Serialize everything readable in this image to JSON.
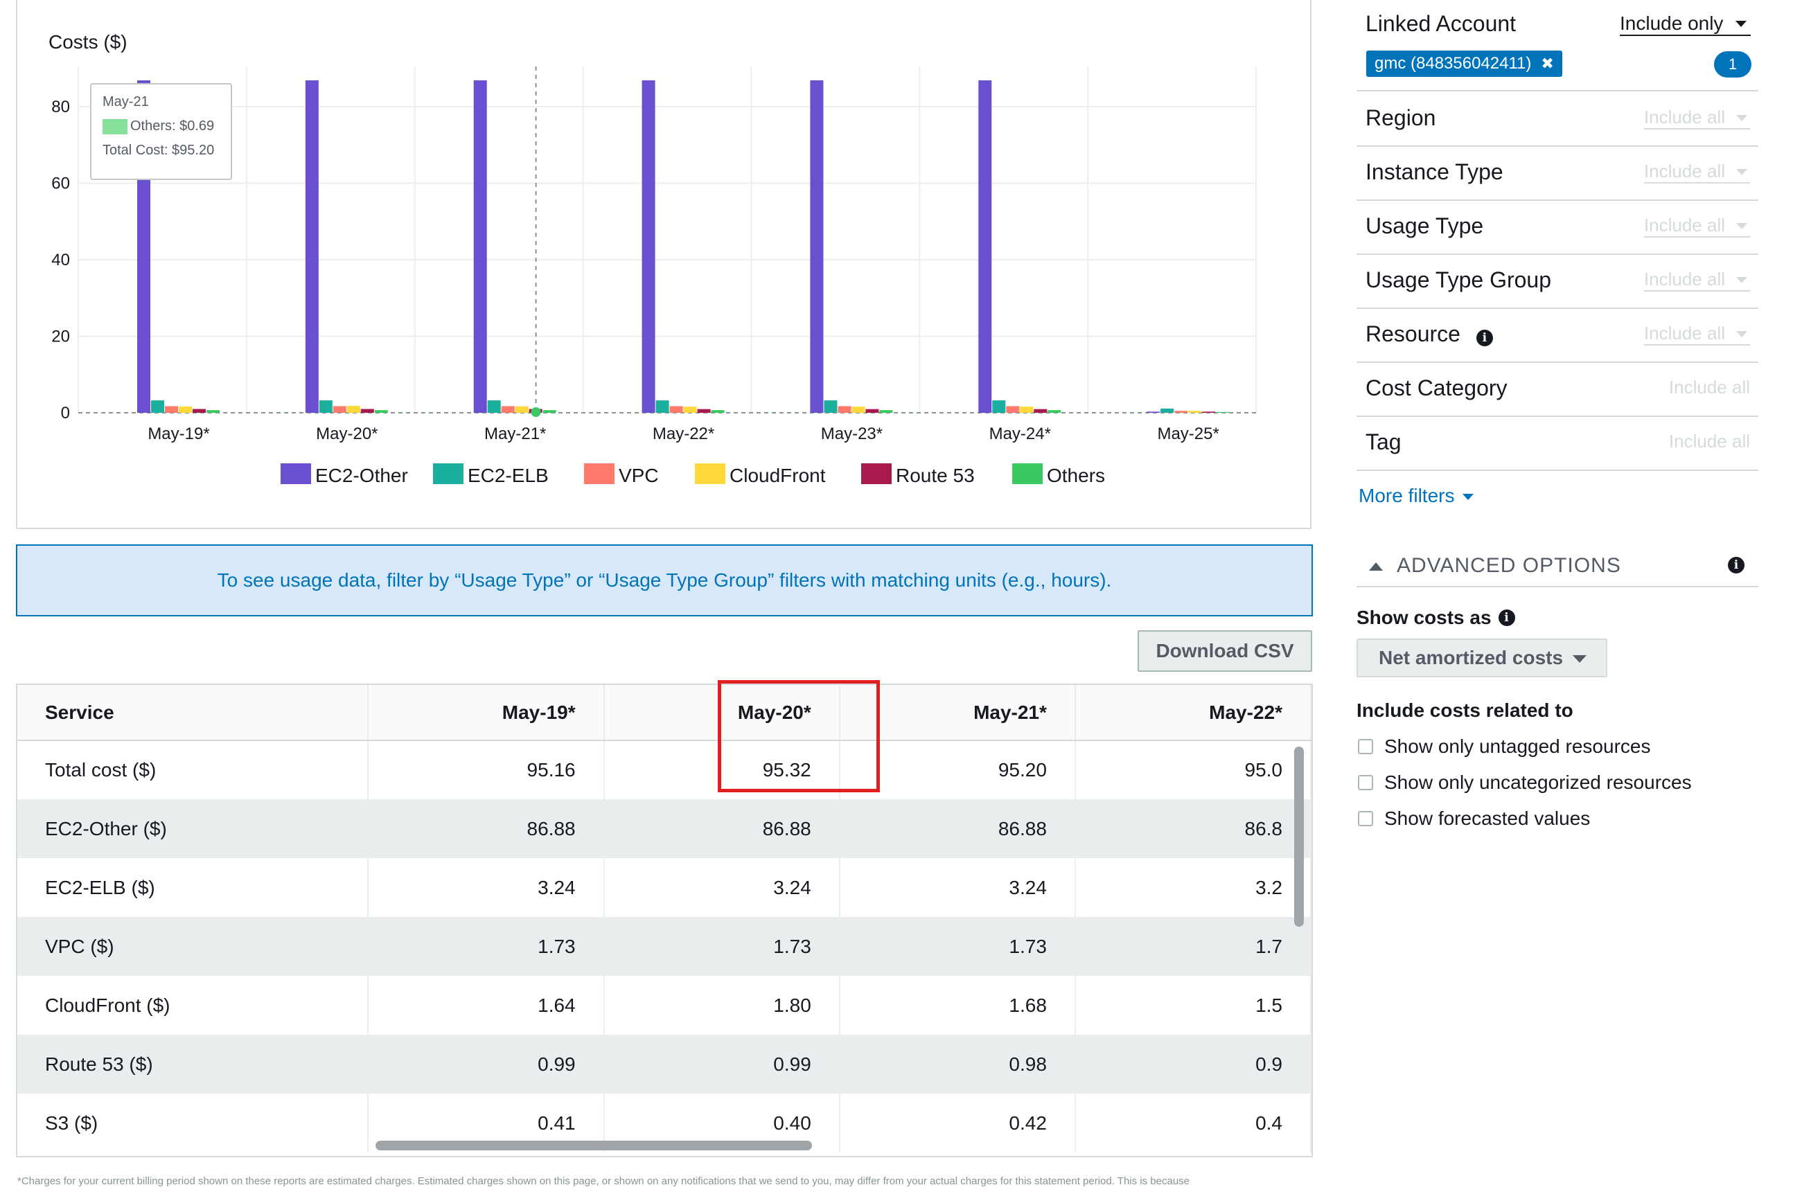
{
  "chart": {
    "ylabel": "Costs ($)",
    "tooltip": {
      "date": "May-21",
      "series_line": "Others: $0.69",
      "total_line": "Total Cost: $95.20"
    }
  },
  "chart_data": {
    "type": "bar",
    "title": "",
    "ylabel": "Costs ($)",
    "ylim": [
      0,
      86.88
    ],
    "yticks": [
      0,
      20,
      40,
      60,
      80
    ],
    "categories": [
      "May-19*",
      "May-20*",
      "May-21*",
      "May-22*",
      "May-23*",
      "May-24*",
      "May-25*"
    ],
    "series": [
      {
        "name": "EC2-Other",
        "color": "#6a4fd1",
        "values": [
          86.88,
          86.88,
          86.88,
          86.88,
          86.88,
          86.88,
          0.3
        ]
      },
      {
        "name": "EC2-ELB",
        "color": "#1bb09e",
        "values": [
          3.24,
          3.24,
          3.24,
          3.24,
          3.24,
          3.24,
          1.1
        ]
      },
      {
        "name": "VPC",
        "color": "#ff7a6b",
        "values": [
          1.73,
          1.73,
          1.73,
          1.73,
          1.73,
          1.73,
          0.5
        ]
      },
      {
        "name": "CloudFront",
        "color": "#ffd83a",
        "values": [
          1.64,
          1.8,
          1.68,
          1.58,
          1.6,
          1.6,
          0.5
        ]
      },
      {
        "name": "Route 53",
        "color": "#a8194e",
        "values": [
          0.99,
          0.99,
          0.98,
          0.96,
          0.96,
          0.96,
          0.3
        ]
      },
      {
        "name": "Others",
        "color": "#3ac961",
        "values": [
          0.69,
          0.69,
          0.69,
          0.69,
          0.69,
          0.69,
          0.2
        ]
      }
    ],
    "grid": true,
    "legend": "bottom"
  },
  "banner": {
    "text": "To see usage data, filter by “Usage Type” or “Usage Type Group” filters with matching units (e.g., hours)."
  },
  "download_button": "Download CSV",
  "table": {
    "columns": [
      "Service",
      "May-19*",
      "May-20*",
      "May-21*",
      "May-22*"
    ],
    "rows": [
      [
        "Total cost ($)",
        "95.16",
        "95.32",
        "95.20",
        "95.0"
      ],
      [
        "EC2-Other ($)",
        "86.88",
        "86.88",
        "86.88",
        "86.8"
      ],
      [
        "EC2-ELB ($)",
        "3.24",
        "3.24",
        "3.24",
        "3.2"
      ],
      [
        "VPC ($)",
        "1.73",
        "1.73",
        "1.73",
        "1.7"
      ],
      [
        "CloudFront ($)",
        "1.64",
        "1.80",
        "1.68",
        "1.5"
      ],
      [
        "Route 53 ($)",
        "0.99",
        "0.99",
        "0.98",
        "0.9"
      ],
      [
        "S3 ($)",
        "0.41",
        "0.40",
        "0.42",
        "0.4"
      ]
    ]
  },
  "footnote": "*Charges for your current billing period shown on these reports are estimated charges. Estimated charges shown on this page, or shown on any notifications that we send to you, may differ from your actual charges for this statement period. This is because",
  "filters": {
    "linked_account": {
      "label": "Linked Account",
      "mode": "Include only",
      "chip": "gmc (848356042411)",
      "count": "1"
    },
    "rows": [
      {
        "label": "Region",
        "value": "Include all"
      },
      {
        "label": "Instance Type",
        "value": "Include all"
      },
      {
        "label": "Usage Type",
        "value": "Include all"
      },
      {
        "label": "Usage Type Group",
        "value": "Include all"
      },
      {
        "label": "Resource",
        "value": "Include all"
      },
      {
        "label": "Cost Category",
        "value": "Include all"
      },
      {
        "label": "Tag",
        "value": "Include all"
      }
    ],
    "more_filters": "More filters"
  },
  "advanced": {
    "title": "ADVANCED OPTIONS",
    "show_costs_label": "Show costs as",
    "show_costs_value": "Net amortized costs",
    "include_costs_label": "Include costs related to",
    "checkboxes": [
      "Show only untagged resources",
      "Show only uncategorized resources",
      "Show forecasted values"
    ]
  }
}
